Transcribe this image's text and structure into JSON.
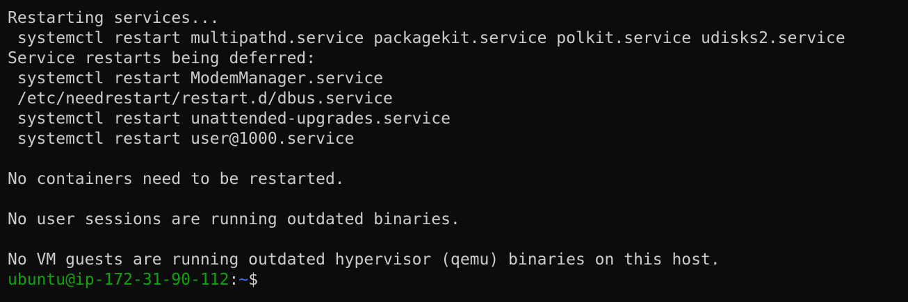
{
  "terminal": {
    "lines": [
      "Restarting services...",
      " systemctl restart multipathd.service packagekit.service polkit.service udisks2.service",
      "Service restarts being deferred:",
      " systemctl restart ModemManager.service",
      " /etc/needrestart/restart.d/dbus.service",
      " systemctl restart unattended-upgrades.service",
      " systemctl restart user@1000.service",
      "",
      "No containers need to be restarted.",
      "",
      "No user sessions are running outdated binaries.",
      "",
      "No VM guests are running outdated hypervisor (qemu) binaries on this host."
    ],
    "prompt": {
      "user_host": "ubuntu@ip-172-31-90-112",
      "separator": ":",
      "path": "~",
      "symbol": "$"
    }
  },
  "colors": {
    "background": "#0c0c0c",
    "text": "#cccccc",
    "prompt_user": "#13a10e",
    "prompt_path": "#3b78ff"
  }
}
